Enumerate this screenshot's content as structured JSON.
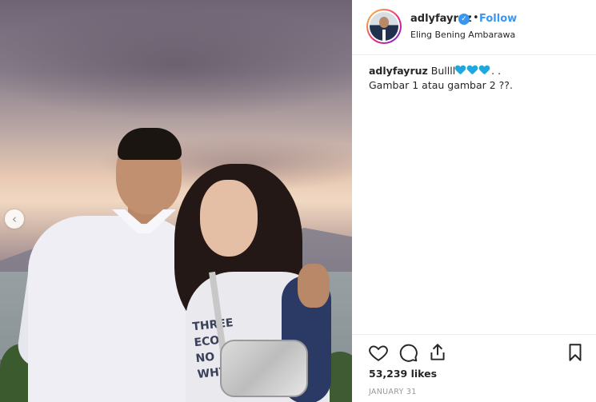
{
  "post": {
    "username": "adlyfayruz",
    "verified_icon": "verified-badge-icon",
    "separator": "•",
    "follow_label": "Follow",
    "location": "Eling Bening Ambarawa",
    "caption": {
      "username": "adlyfayruz",
      "text_prefix": "Bullll",
      "text_suffix": ". .",
      "line2": "Gambar 1 atau gambar 2 ??.",
      "emoji_count": 3,
      "emoji_icon": "blue-heart-icon",
      "emoji_color": "#1fa7e0"
    },
    "likes": "53,239 likes",
    "date": "JANUARY 31"
  },
  "photo": {
    "carousel_prev_icon": "chevron-left-icon",
    "carousel_prev_glyph": "‹",
    "shirt_print": [
      "THREE",
      "ECO",
      "NO",
      "WHYS"
    ]
  },
  "actions": {
    "like_icon": "heart-outline-icon",
    "comment_icon": "comment-icon",
    "share_icon": "share-icon",
    "save_icon": "bookmark-icon"
  },
  "colors": {
    "accent": "#3897f0",
    "text": "#262626",
    "muted": "#999999"
  }
}
